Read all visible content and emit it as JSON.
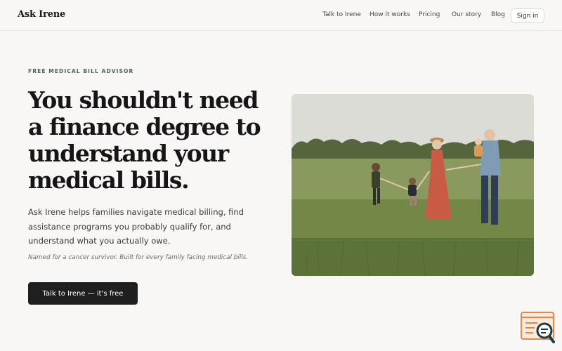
{
  "header": {
    "brand": "Ask Irene",
    "nav": [
      "Talk to Irene",
      "How it works",
      "Pricing",
      "Our story",
      "Blog"
    ],
    "signin_label": "Sign in"
  },
  "hero": {
    "eyebrow": "FREE MEDICAL BILL ADVISOR",
    "headline": "You shouldn't need a finance degree to understand your medical bills.",
    "description": "Ask Irene helps families navigate medical billing, find assistance programs you probably qualify for, and understand what you actually owe.",
    "tagline": "Named for a cancer survivor. Built for every family facing medical bills.",
    "cta_label": "Talk to Irene — it's free",
    "image_alt": "Family walking hand in hand through a grassy field"
  },
  "colors": {
    "accent": "#1f1f1f",
    "eyebrow": "#4d6150",
    "background": "#f8f7f5"
  },
  "icons": {
    "chat_widget": "chat-search-icon"
  }
}
